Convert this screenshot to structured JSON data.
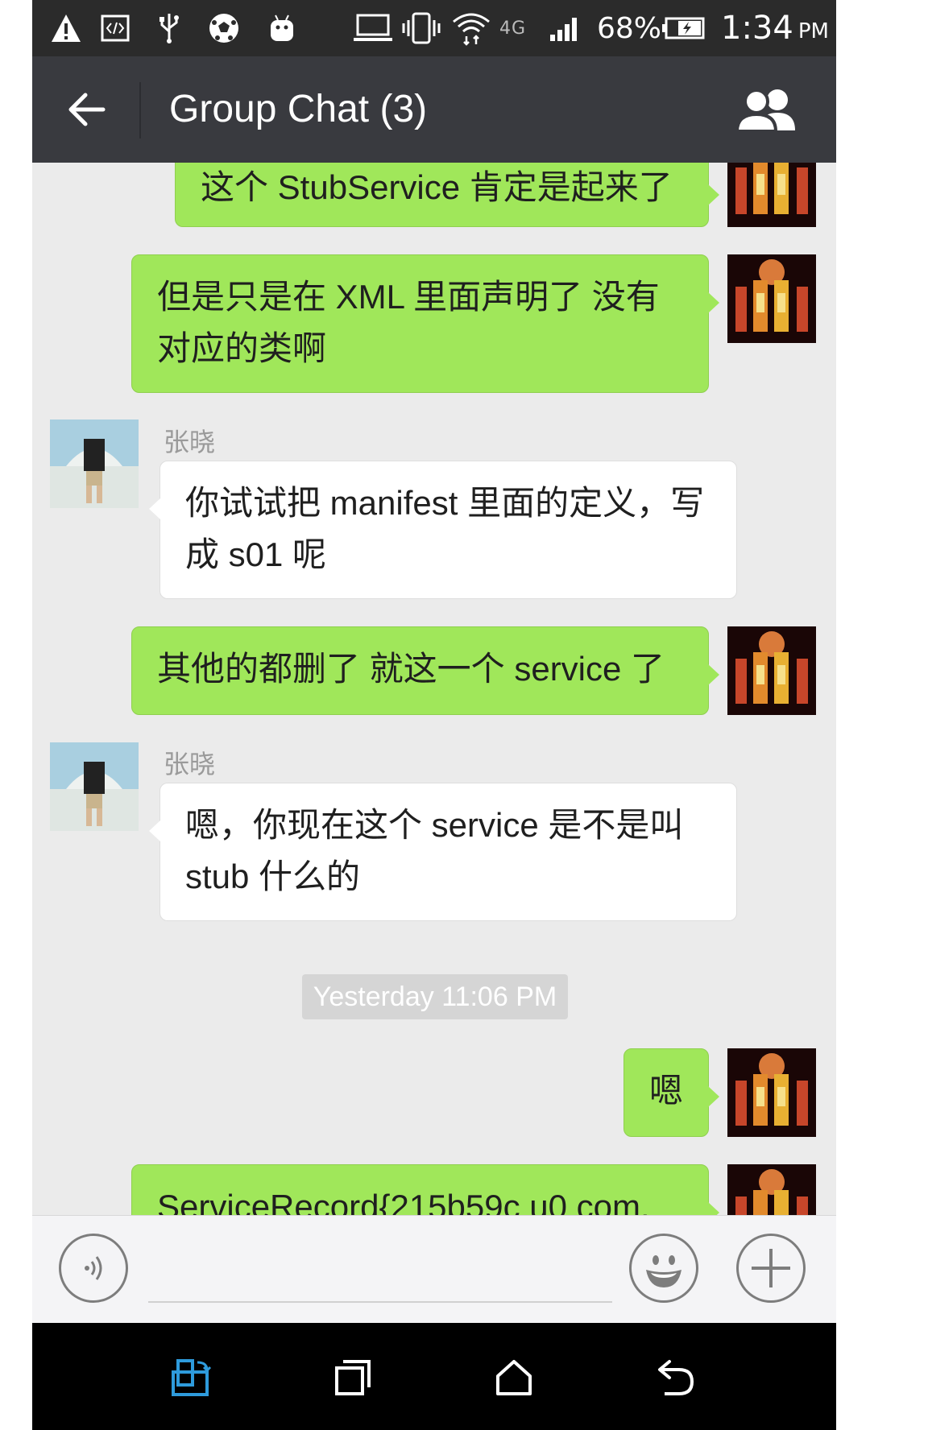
{
  "status_bar": {
    "battery": "68%",
    "time": "1:34",
    "ampm": "PM",
    "network_type": "4G",
    "icons": [
      "warning-icon",
      "code-icon",
      "usb-icon",
      "soccer-icon",
      "android-icon",
      "laptop-icon",
      "vibrate-icon",
      "wifi-icon",
      "network-4g-icon",
      "signal-icon",
      "battery-charging-icon"
    ]
  },
  "header": {
    "title": "Group Chat (3)",
    "back_icon": "arrow-left-icon",
    "members_icon": "group-members-icon"
  },
  "messages": [
    {
      "direction": "out",
      "text": "这个 StubService 肯定是起来了"
    },
    {
      "direction": "out",
      "text": "但是只是在 XML 里面声明了 没有对应的类啊"
    },
    {
      "direction": "in",
      "sender": "张晓",
      "text": "你试试把 manifest 里面的定义，写成 s01 呢"
    },
    {
      "direction": "out",
      "text": "其他的都删了 就这一个 service 了"
    },
    {
      "direction": "in",
      "sender": "张晓",
      "text": "嗯，你现在这个 service 是不是叫 stub 什么的"
    },
    {
      "direction": "out",
      "text": "嗯"
    },
    {
      "direction": "out",
      "text": "ServiceRecord{215b59c u0 com."
    }
  ],
  "timestamp": "Yesterday 11:06 PM",
  "input_bar": {
    "voice_icon": "voice-icon",
    "emoji_icon": "emoji-icon",
    "more_icon": "plus-icon",
    "placeholder": ""
  },
  "nav_bar": {
    "icons": [
      "screen-rotate-icon",
      "recent-apps-icon",
      "home-icon",
      "back-icon"
    ]
  },
  "colors": {
    "out_bubble": "#a0e75a",
    "in_bubble": "#ffffff",
    "header_bg": "#393a3f",
    "chat_bg": "#ebebeb",
    "nav_accent": "#2e9bdc"
  }
}
